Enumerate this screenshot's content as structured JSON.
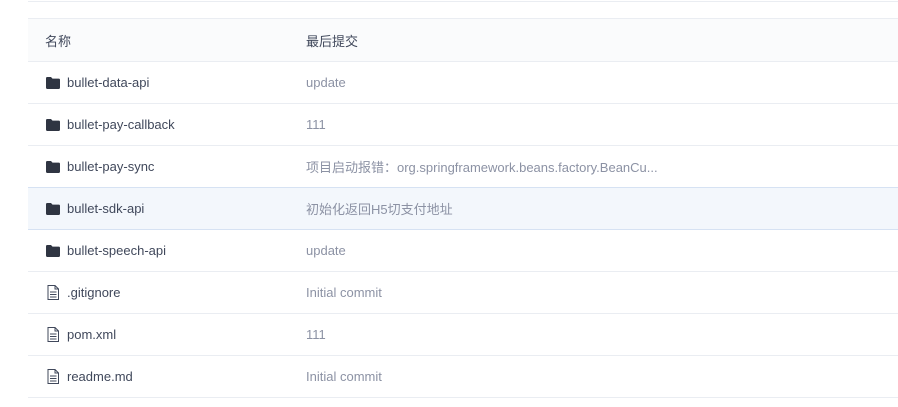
{
  "table": {
    "header": {
      "name": "名称",
      "commit": "最后提交"
    },
    "rows": [
      {
        "type": "folder",
        "icon": "folder-icon",
        "name": "bullet-data-api",
        "commit": "update",
        "highlight": false
      },
      {
        "type": "folder",
        "icon": "folder-icon",
        "name": "bullet-pay-callback",
        "commit": "111",
        "highlight": false
      },
      {
        "type": "folder",
        "icon": "folder-icon",
        "name": "bullet-pay-sync",
        "commit": "项目启动报错：org.springframework.beans.factory.BeanCu...",
        "highlight": false
      },
      {
        "type": "folder",
        "icon": "folder-icon",
        "name": "bullet-sdk-api",
        "commit": "初始化返回H5切支付地址",
        "highlight": true
      },
      {
        "type": "folder",
        "icon": "folder-icon",
        "name": "bullet-speech-api",
        "commit": "update",
        "highlight": false
      },
      {
        "type": "file",
        "icon": "file-icon",
        "name": ".gitignore",
        "commit": "Initial commit",
        "highlight": false
      },
      {
        "type": "file",
        "icon": "file-icon",
        "name": "pom.xml",
        "commit": "111",
        "highlight": false
      },
      {
        "type": "file",
        "icon": "file-icon",
        "name": "readme.md",
        "commit": "Initial commit",
        "highlight": false
      }
    ]
  },
  "colors": {
    "text": "#40485b",
    "muted": "#8c92a4",
    "border": "#eaedf2",
    "highlight_bg": "#f3f7fc",
    "icon": "#2f3542"
  }
}
